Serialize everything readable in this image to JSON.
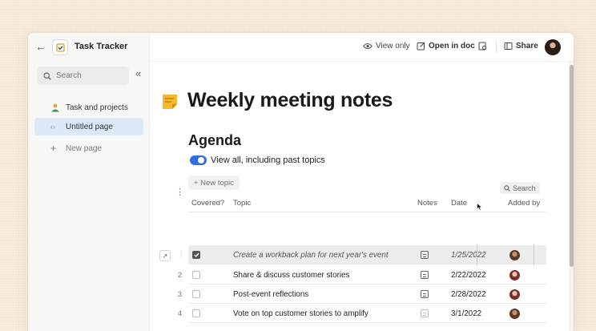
{
  "app": {
    "title": "Task Tracker"
  },
  "sidebar": {
    "search_placeholder": "Search",
    "items": [
      {
        "label": "Task and projects",
        "icon": "people-icon"
      },
      {
        "label": "Untitled page",
        "icon": "code-brackets-icon",
        "active": true
      },
      {
        "label": "New page",
        "icon": "plus-icon"
      }
    ]
  },
  "topbar": {
    "view_only": "View only",
    "open_in_doc": "Open in doc",
    "share": "Share"
  },
  "doc": {
    "title": "Weekly meeting notes",
    "section": "Agenda",
    "toggle_label": "View all, including past topics",
    "new_topic": "+ New topic",
    "table_search": "Search"
  },
  "table": {
    "headers": {
      "covered": "Covered?",
      "topic": "Topic",
      "notes": "Notes",
      "date": "Date",
      "added_by": "Added by"
    },
    "rows": [
      {
        "num": "",
        "covered": true,
        "topic": "Create a workback plan for next year's event",
        "date": "1/25/2022"
      },
      {
        "num": "2",
        "covered": false,
        "topic": "Share & discuss customer stories",
        "date": "2/22/2022"
      },
      {
        "num": "3",
        "covered": false,
        "topic": "Post-event reflections",
        "date": "2/28/2022"
      },
      {
        "num": "4",
        "covered": false,
        "topic": "Vote on top customer stories to amplify",
        "date": "3/1/2022"
      }
    ]
  },
  "colors": {
    "accent": "#2f6ee0",
    "active_item": "#dbe8f7",
    "doc_icon": "#f5b82e"
  }
}
